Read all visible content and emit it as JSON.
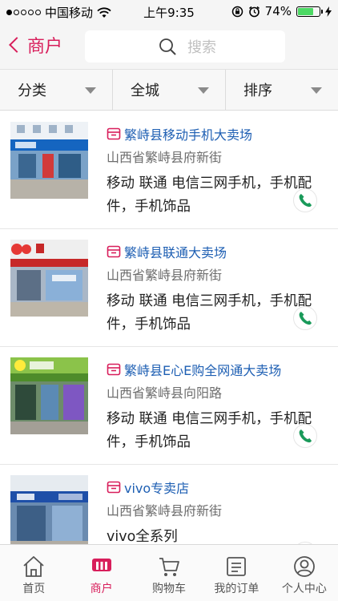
{
  "status_bar": {
    "carrier": "中国移动",
    "time": "上午9:35",
    "battery": "74%",
    "battery_level": 0.74
  },
  "nav": {
    "back_label": "商户",
    "search_placeholder": "搜索"
  },
  "filters": [
    {
      "label": "分类"
    },
    {
      "label": "全城"
    },
    {
      "label": "排序"
    }
  ],
  "merchants": [
    {
      "name": "繁峙县移动手机大卖场",
      "address": "山西省繁峙县府新街",
      "description": "移动 联通 电信三网手机，手机配件，手机饰品"
    },
    {
      "name": "繁峙县联通大卖场",
      "address": "山西省繁峙县府新街",
      "description": "移动 联通 电信三网手机，手机配件，手机饰品"
    },
    {
      "name": "繁峙县E心E购全网通大卖场",
      "address": "山西省繁峙县向阳路",
      "description": "移动 联通 电信三网手机，手机配件，手机饰品"
    },
    {
      "name": "vivo专卖店",
      "address": "山西省繁峙县府新街",
      "description": "vivo全系列"
    }
  ],
  "tabs": [
    {
      "label": "首页",
      "icon": "home-icon"
    },
    {
      "label": "商户",
      "icon": "merchant-icon"
    },
    {
      "label": "购物车",
      "icon": "cart-icon"
    },
    {
      "label": "我的订单",
      "icon": "orders-icon"
    },
    {
      "label": "个人中心",
      "icon": "profile-icon"
    }
  ],
  "colors": {
    "accent": "#d81e5b",
    "link": "#1e5fb3",
    "phone": "#1a9a5a"
  }
}
